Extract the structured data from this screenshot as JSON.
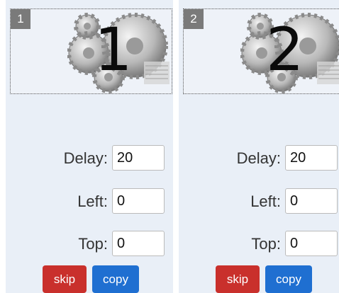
{
  "frames": [
    {
      "number": "1",
      "big_digit": "1",
      "delay_label": "Delay:",
      "delay_value": "20",
      "left_label": "Left:",
      "left_value": "0",
      "top_label": "Top:",
      "top_value": "0",
      "skip_label": "skip",
      "copy_label": "copy"
    },
    {
      "number": "2",
      "big_digit": "2",
      "delay_label": "Delay:",
      "delay_value": "20",
      "left_label": "Left:",
      "left_value": "0",
      "top_label": "Top:",
      "top_value": "0",
      "skip_label": "skip",
      "copy_label": "copy"
    }
  ],
  "colors": {
    "panel_bg": "#e9eff7",
    "skip": "#c9302c",
    "copy": "#1f6fd1",
    "badge": "#7a7a7a"
  },
  "icons": {
    "thumbnail": "gears-image"
  }
}
